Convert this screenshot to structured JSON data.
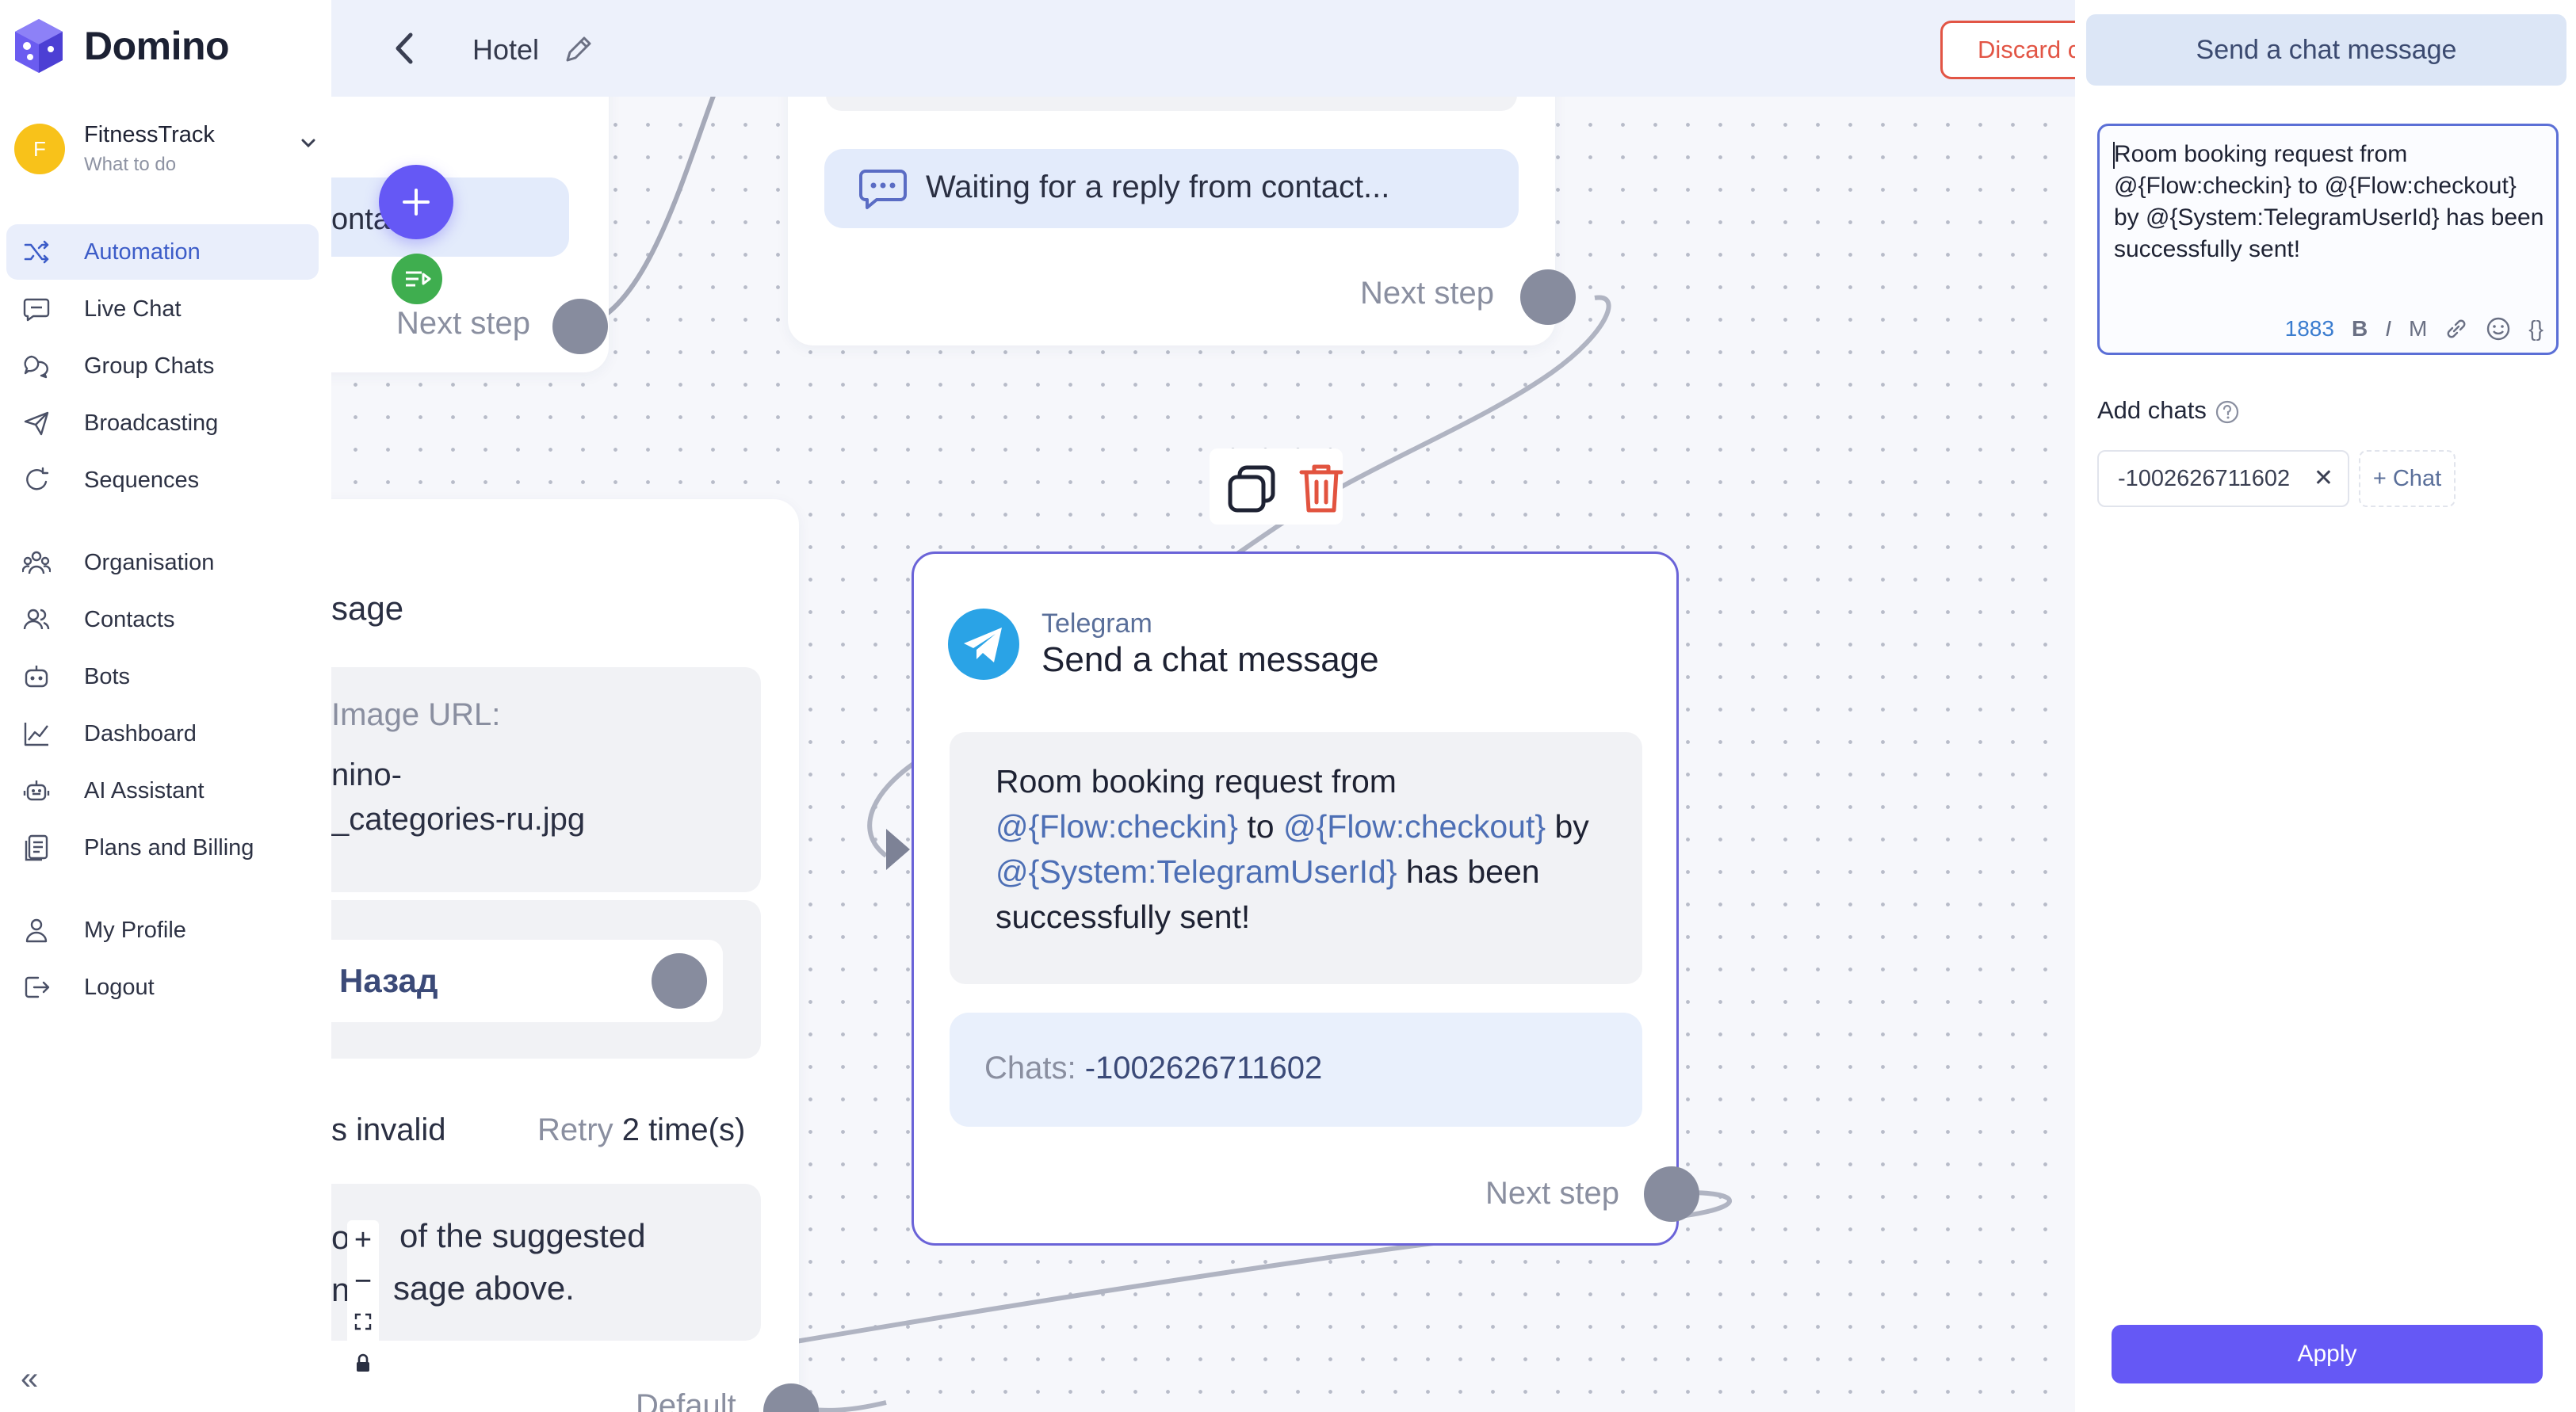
{
  "app": {
    "name": "Domino"
  },
  "workspace": {
    "avatar_letter": "F",
    "name": "FitnessTrack",
    "subtitle": "What to do"
  },
  "sidebar": {
    "items": [
      {
        "label": "Automation",
        "icon": "shuffle-icon",
        "active": true
      },
      {
        "label": "Live Chat",
        "icon": "chat-bubble-icon"
      },
      {
        "label": "Group Chats",
        "icon": "group-chat-icon"
      },
      {
        "label": "Broadcasting",
        "icon": "send-icon"
      },
      {
        "label": "Sequences",
        "icon": "loop-icon"
      },
      {
        "label": "Organisation",
        "icon": "organisation-icon"
      },
      {
        "label": "Contacts",
        "icon": "contacts-icon"
      },
      {
        "label": "Bots",
        "icon": "bot-icon"
      },
      {
        "label": "Dashboard",
        "icon": "chart-line-icon"
      },
      {
        "label": "AI Assistant",
        "icon": "ai-robot-icon"
      },
      {
        "label": "Plans and Billing",
        "icon": "billing-icon"
      },
      {
        "label": "My Profile",
        "icon": "user-icon"
      },
      {
        "label": "Logout",
        "icon": "logout-icon"
      }
    ],
    "collapse_label": "«"
  },
  "header": {
    "title": "Hotel",
    "discard_label": "Discard c"
  },
  "canvas": {
    "left_node": {
      "truncated_label": "onta",
      "next_step": "Next step"
    },
    "wait_node": {
      "waiting_text": "Waiting for a reply from contact...",
      "next_step": "Next step"
    },
    "image_node": {
      "title_partial": "sage",
      "image_url_label": "Image URL:",
      "image_url_line1": "nino-",
      "image_url_line2": "_categories-ru.jpg",
      "button_label": "Назад",
      "invalid_label": "s invalid",
      "retry_prefix": "Retry",
      "retry_count": "2 time(s)",
      "suggest_line1": "of the suggested",
      "suggest_line2": "sage above.",
      "suggest_frag1": "o",
      "suggest_frag2": "n",
      "default_label": "Default"
    },
    "telegram_node": {
      "channel": "Telegram",
      "title": "Send a chat message",
      "message_plain1": "Room booking request from",
      "message_var1": "@{Flow:checkin}",
      "message_plain2": " to ",
      "message_var2": "@{Flow:checkout}",
      "message_plain3": " by",
      "message_var3": "@{System:TelegramUserId}",
      "message_plain4": " has been",
      "message_plain5": "successfully sent!",
      "chats_label": "Chats: ",
      "chats_value": "-1002626711602",
      "next_step": "Next step"
    },
    "zoom_controls": {
      "zoom_in": "+",
      "zoom_out": "−"
    }
  },
  "panel": {
    "title": "Send a chat message",
    "message": "Room booking request from @{Flow:checkin} to @{Flow:checkout} by @{System:TelegramUserId} has been successfully sent!",
    "char_count": "1883",
    "toolbar": {
      "bold": "B",
      "italic": "I",
      "mono": "M",
      "variables": "{}"
    },
    "add_chats_label": "Add chats",
    "chip_value": "-1002626711602",
    "chip_remove": "✕",
    "add_chat_label": "+ Chat",
    "apply_label": "Apply"
  },
  "colors": {
    "accent": "#6558f5",
    "active_nav": "#3c5cc8",
    "discard": "#e25545",
    "node_border": "#6a63d8",
    "telegram": "#2aa3e6"
  }
}
